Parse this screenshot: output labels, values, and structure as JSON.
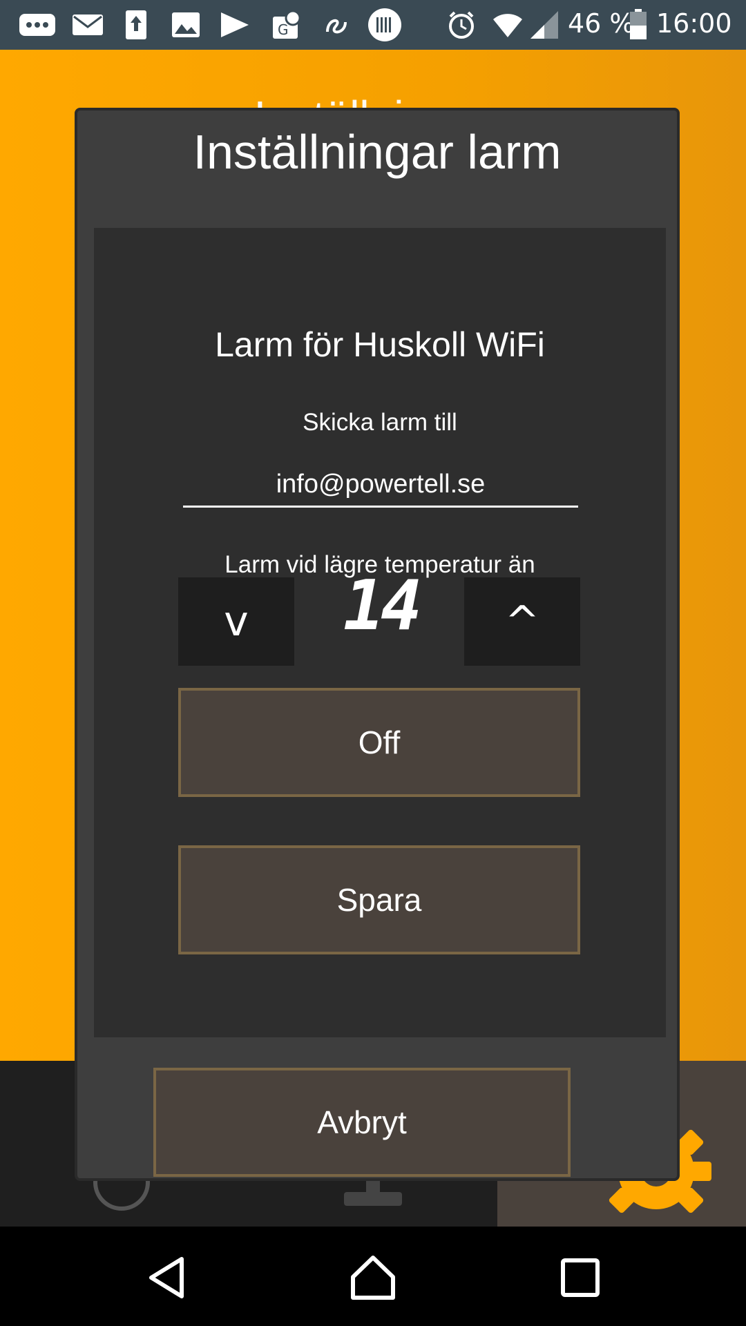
{
  "status_bar": {
    "icons": [
      "more-icon",
      "mail-icon",
      "upload-icon",
      "image-icon",
      "play-icon",
      "maps-icon",
      "snapseed-icon",
      "barcode-icon",
      "alarm-icon",
      "wifi-icon",
      "signal-icon",
      "battery-icon"
    ],
    "battery": "46 %",
    "time": "16:00"
  },
  "background": {
    "title": "Inställningar"
  },
  "dialog": {
    "title": "Inställningar larm",
    "heading": "Larm för Huskoll WiFi",
    "send_label": "Skicka larm till",
    "email_value": "info@powertell.se",
    "temp_label": "Larm vid lägre temperatur än",
    "temperature": "14",
    "down_label": "v",
    "up_label": "^",
    "off_label": "Off",
    "save_label": "Spara",
    "cancel_label": "Avbryt"
  },
  "colors": {
    "accent": "#ffa800",
    "button_border": "#7a6645",
    "button_bg": "#4a423c"
  },
  "nav": {
    "icons": [
      "back-icon",
      "home-icon",
      "recents-icon"
    ]
  }
}
